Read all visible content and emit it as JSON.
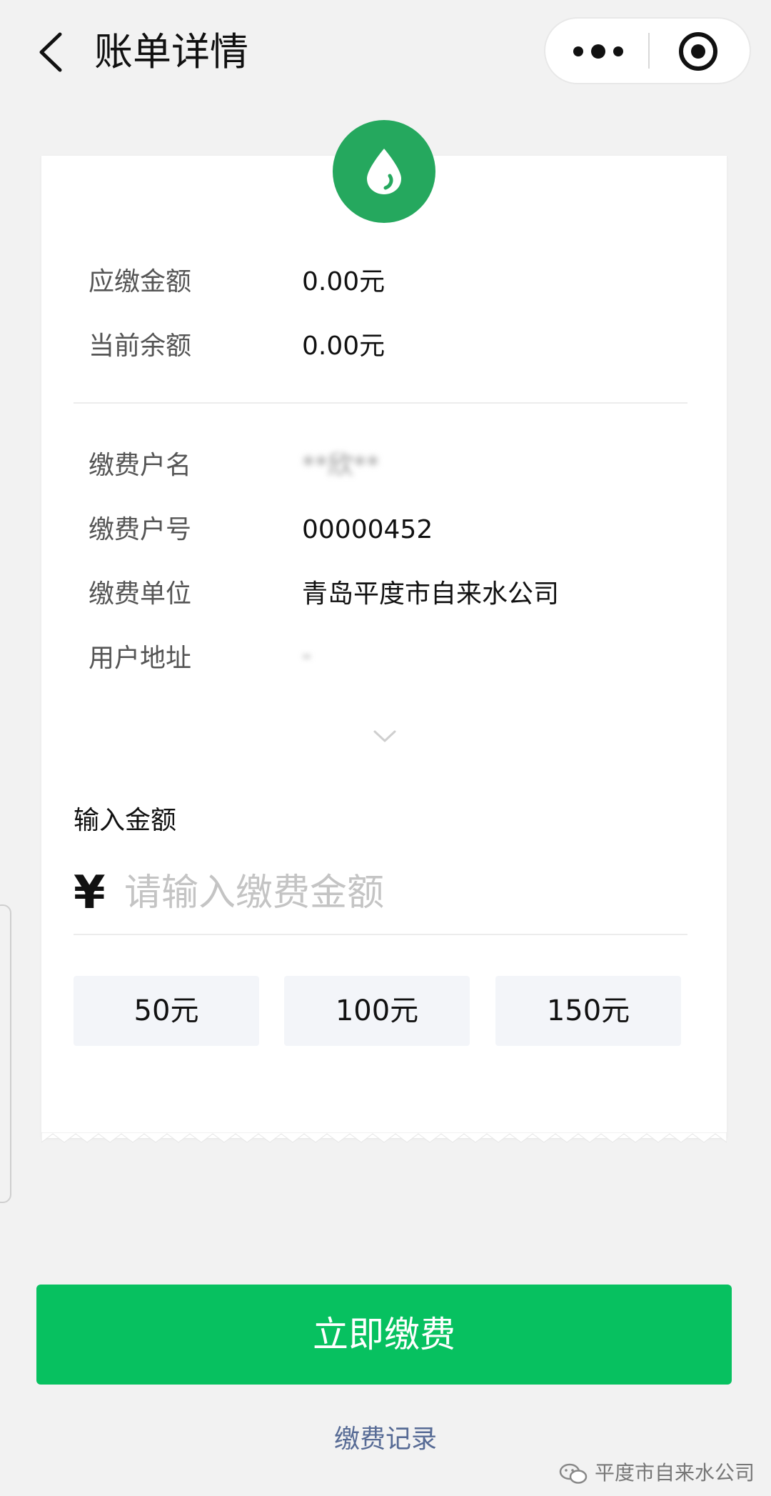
{
  "header": {
    "title": "账单详情"
  },
  "bill": {
    "due_label": "应缴金额",
    "due_value": "0.00元",
    "balance_label": "当前余额",
    "balance_value": "0.00元"
  },
  "account": {
    "name_label": "缴费户名",
    "name_value": "**欣**",
    "number_label": "缴费户号",
    "number_value": "00000452",
    "company_label": "缴费单位",
    "company_value": "青岛平度市自来水公司",
    "address_label": "用户地址",
    "address_value": "-"
  },
  "amount": {
    "label": "输入金额",
    "currency_symbol": "¥",
    "placeholder": "请输入缴费金额",
    "presets": [
      "50元",
      "100元",
      "150元"
    ]
  },
  "actions": {
    "pay_label": "立即缴费",
    "history_label": "缴费记录"
  },
  "watermark": {
    "text": "平度市自来水公司"
  },
  "colors": {
    "primary_green": "#07c160",
    "icon_green": "#25a85e",
    "link_blue": "#576b95"
  }
}
